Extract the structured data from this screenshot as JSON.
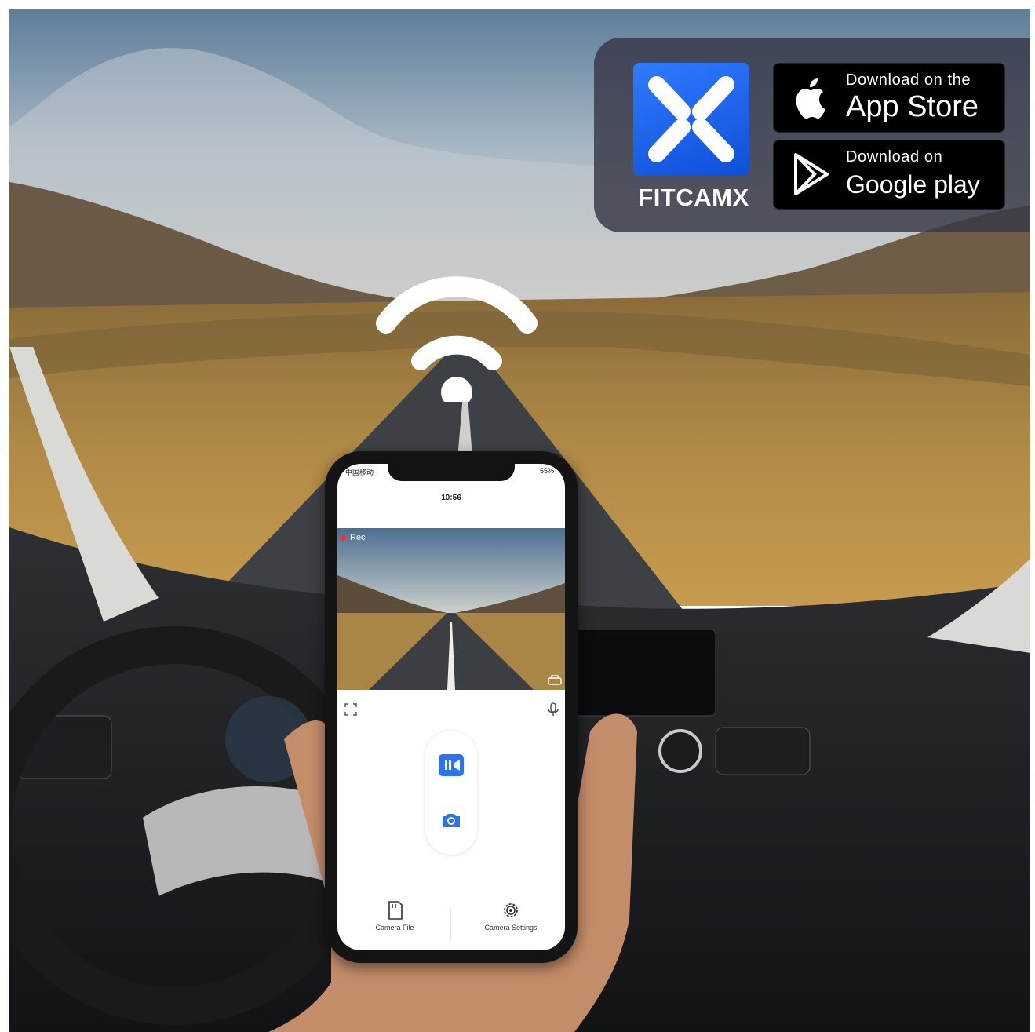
{
  "app": {
    "name": "FITCAMX"
  },
  "stores": [
    {
      "small_label": "Download on the",
      "big_label": "App Store",
      "icon": "apple-icon"
    },
    {
      "small_label": "Download on",
      "big_label": "Google play",
      "icon": "google-play-icon"
    }
  ],
  "phone": {
    "carrier": "中国移动",
    "battery": "55%",
    "time": "10:56",
    "rec_label": "Rec",
    "controls": [
      {
        "icon": "pause-record-icon",
        "color": "#2d72f0"
      },
      {
        "icon": "camera-snapshot-icon",
        "color": "#2d72f0"
      }
    ],
    "tabs": [
      {
        "label": "Camera File",
        "icon": "sd-card-icon"
      },
      {
        "label": "Camera Settings",
        "icon": "gear-icon"
      }
    ]
  },
  "colors": {
    "accent": "#2d72f0",
    "badge_bg": "#373746",
    "icon_blue": "#1f63ee"
  }
}
